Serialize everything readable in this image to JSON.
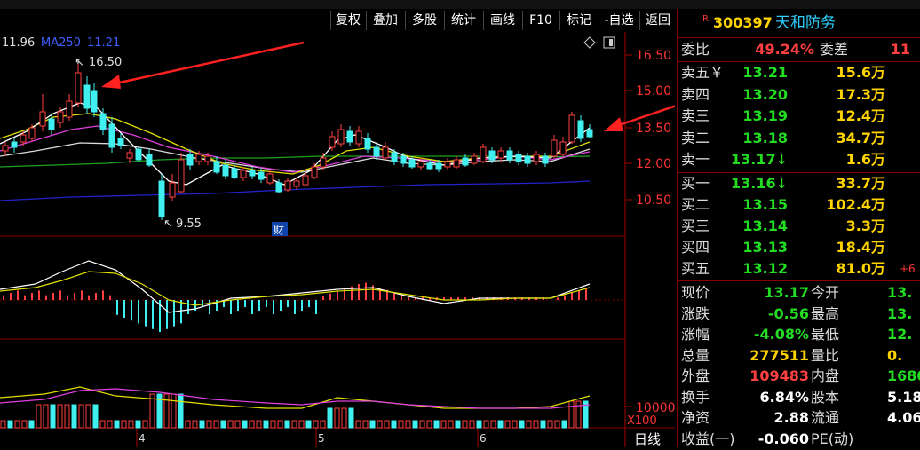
{
  "top_strip": "",
  "toolbar": {
    "buttons": [
      "复权",
      "叠加",
      "多股",
      "统计",
      "画线",
      "F10",
      "标记",
      "-自选",
      "返回"
    ],
    "diamond_icon": "diamond-icon",
    "window_icon": "window-icon"
  },
  "main_chart": {
    "ma_label_value": "11.96",
    "ma250_label": "MA250",
    "ma250_value": "11.21",
    "high_marker": "16.50",
    "low_marker": "9.55",
    "finance_badge": "财",
    "y_ticks": [
      "16.50",
      "15.00",
      "13.50",
      "12.00",
      "10.50"
    ],
    "month_labels": [
      "4",
      "5",
      "6"
    ]
  },
  "volume_chart": {
    "tick": "10000",
    "unit": "X100"
  },
  "bottom_label": "日线",
  "stock": {
    "badge": "R",
    "code": "300397",
    "name": "天和防务"
  },
  "order_book": {
    "ratio_label": "委比",
    "ratio_value": "49.24%",
    "diff_label": "委差",
    "diff_value": "11",
    "asks": [
      {
        "label": "卖五",
        "suffix": "￥",
        "price": "13.21",
        "vol": "15.6万"
      },
      {
        "label": "卖四",
        "suffix": "",
        "price": "13.20",
        "vol": "17.3万"
      },
      {
        "label": "卖三",
        "suffix": "",
        "price": "13.19",
        "vol": "12.4万"
      },
      {
        "label": "卖二",
        "suffix": "",
        "price": "13.18",
        "vol": "34.7万"
      },
      {
        "label": "卖一",
        "suffix": "",
        "price": "13.17",
        "arrow": "↓",
        "vol": "1.6万"
      }
    ],
    "bids": [
      {
        "label": "买一",
        "price": "13.16",
        "arrow": "↓",
        "vol": "33.7万"
      },
      {
        "label": "买二",
        "price": "13.15",
        "vol": "102.4万"
      },
      {
        "label": "买三",
        "price": "13.14",
        "vol": "3.3万"
      },
      {
        "label": "买四",
        "price": "13.13",
        "vol": "18.4万"
      },
      {
        "label": "买五",
        "price": "13.12",
        "vol": "81.0万",
        "extra": "+6"
      }
    ]
  },
  "stats": [
    {
      "l1": "现价",
      "v1": "13.17",
      "l2": "今开",
      "v2": "13.",
      "c1": "green",
      "c2": "green"
    },
    {
      "l1": "涨跌",
      "v1": "-0.56",
      "l2": "最高",
      "v2": "13.",
      "c1": "green",
      "c2": "green"
    },
    {
      "l1": "涨幅",
      "v1": "-4.08%",
      "l2": "最低",
      "v2": "12.",
      "c1": "green",
      "c2": "green"
    },
    {
      "l1": "总量",
      "v1": "277511",
      "l2": "量比",
      "v2": "0.",
      "c1": "yellow",
      "c2": "yellow"
    },
    {
      "l1": "外盘",
      "v1": "109483",
      "l2": "内盘",
      "v2": "1680",
      "c1": "red",
      "c2": "green"
    },
    {
      "l1": "换手",
      "v1": "6.84%",
      "l2": "股本",
      "v2": "5.18",
      "c1": "white",
      "c2": "white"
    },
    {
      "l1": "净资",
      "v1": "2.88",
      "l2": "流通",
      "v2": "4.06",
      "c1": "white",
      "c2": "white"
    },
    {
      "l1": "收益(一)",
      "v1": "-0.060",
      "l2": "PE(动)",
      "v2": "",
      "c1": "white",
      "c2": "white"
    }
  ]
}
